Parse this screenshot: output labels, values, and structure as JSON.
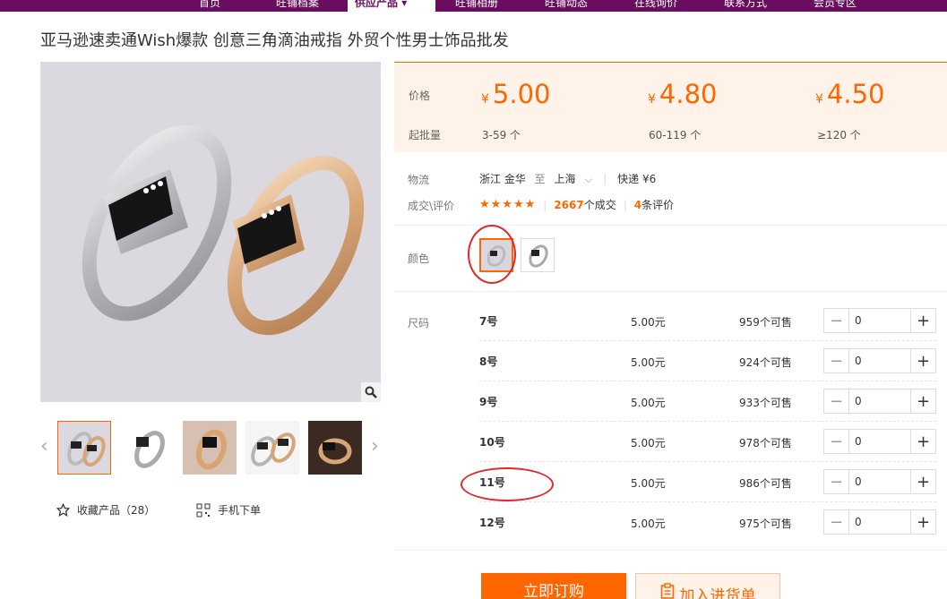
{
  "nav": {
    "items": [
      "首页",
      "旺铺档案",
      "供应产品",
      "旺铺相册",
      "旺铺动态",
      "在线询价",
      "联系方式",
      "会员专区"
    ]
  },
  "product": {
    "title": "亚马逊速卖通Wish爆款 创意三角滴油戒指 外贸个性男士饰品批发"
  },
  "gallery": {
    "thumb_count": 5,
    "selected_thumb": 0
  },
  "actions": {
    "favorite": "收藏产品（28）",
    "mobile_order": "手机下单"
  },
  "price": {
    "price_label": "价格",
    "moq_label": "起批量",
    "currency": "¥",
    "tiers": [
      {
        "price": "5.00",
        "range": "3-59 个"
      },
      {
        "price": "4.80",
        "range": "60-119 个"
      },
      {
        "price": "4.50",
        "range": "≥120 个"
      }
    ]
  },
  "logistics": {
    "label": "物流",
    "from": "浙江 金华",
    "to_word": "至",
    "to": "上海",
    "express": "快递 ¥6"
  },
  "deals": {
    "label": "成交\\评价",
    "stars": "★★★★★",
    "deal_count": "2667",
    "deal_suffix": "个成交",
    "review_count": "4",
    "review_suffix": "条评价"
  },
  "color": {
    "label": "颜色"
  },
  "size": {
    "label": "尺码",
    "rows": [
      {
        "size": "7号",
        "price": "5.00元",
        "stock": "959个可售",
        "qty": "0"
      },
      {
        "size": "8号",
        "price": "5.00元",
        "stock": "924个可售",
        "qty": "0"
      },
      {
        "size": "9号",
        "price": "5.00元",
        "stock": "933个可售",
        "qty": "0"
      },
      {
        "size": "10号",
        "price": "5.00元",
        "stock": "978个可售",
        "qty": "0"
      },
      {
        "size": "11号",
        "price": "5.00元",
        "stock": "986个可售",
        "qty": "0"
      },
      {
        "size": "12号",
        "price": "5.00元",
        "stock": "975个可售",
        "qty": "0"
      }
    ]
  },
  "buttons": {
    "buy_now": "立即订购",
    "add_to_cart": "加入进货单"
  },
  "colors": {
    "nav_bg": "#6b0d5e",
    "accent": "#ff6600",
    "annotation": "#e02a2a"
  }
}
